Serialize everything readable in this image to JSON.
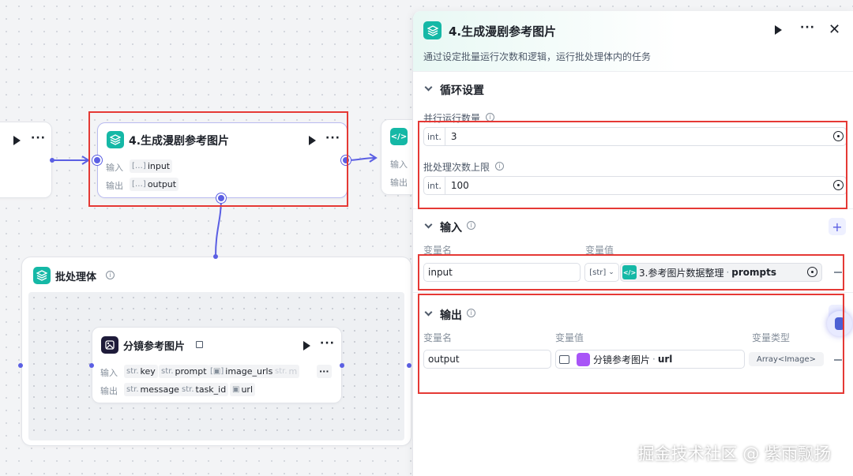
{
  "canvas": {
    "prev_node": {},
    "main_node": {
      "title": "4.生成漫剧参考图片",
      "input_label": "输入",
      "output_label": "输出",
      "input_chip": "input",
      "output_chip": "output"
    },
    "next_node": {
      "input_label": "输入",
      "output_label": "输出"
    },
    "batch_container": {
      "title": "批处理体"
    },
    "child_node": {
      "title": "分镜参考图片",
      "input_label": "输入",
      "output_label": "输出",
      "inputs": [
        {
          "type": "str.",
          "name": "key"
        },
        {
          "type": "str.",
          "name": "prompt"
        },
        {
          "type": "img",
          "name": "image_urls"
        },
        {
          "type": "str.",
          "name": "m"
        }
      ],
      "outputs": [
        {
          "type": "str.",
          "name": "message"
        },
        {
          "type": "str.",
          "name": "task_id"
        },
        {
          "type": "img",
          "name": "url"
        }
      ]
    }
  },
  "panel": {
    "title": "4.生成漫剧参考图片",
    "description": "通过设定批量运行次数和逻辑，运行批处理体内的任务",
    "loop_section": {
      "title": "循环设置",
      "parallel_label": "并行运行数量",
      "parallel_type": "int.",
      "parallel_value": "3",
      "batch_limit_label": "批处理次数上限",
      "batch_limit_type": "int.",
      "batch_limit_value": "100"
    },
    "input_section": {
      "title": "输入",
      "col_name": "变量名",
      "col_value": "变量值",
      "var_name": "input",
      "var_type_tag": "[str]",
      "ref_node": "3.参考图片数据整理",
      "ref_field": "prompts"
    },
    "output_section": {
      "title": "输出",
      "col_name": "变量名",
      "col_value": "变量值",
      "col_type": "变量类型",
      "var_name": "output",
      "ref_node": "分镜参考图片",
      "ref_field": "url",
      "var_type": "Array<Image>"
    }
  },
  "watermark": "掘金技术社区 @ 紫雨飘扬",
  "colors": {
    "accent": "#5b5fe3",
    "teal": "#15b8a6",
    "highlight": "#e53935"
  }
}
